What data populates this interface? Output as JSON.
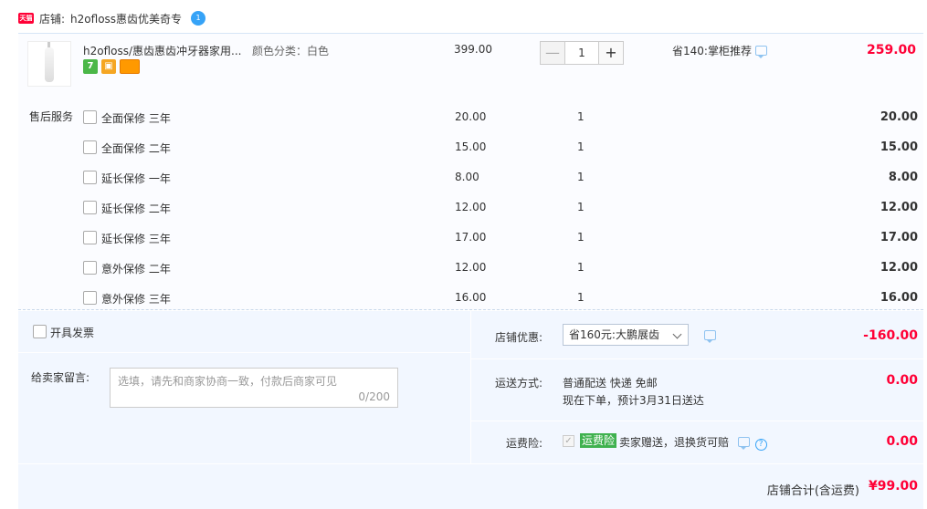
{
  "shop": {
    "platform_badge": "天猫",
    "label": "店铺:",
    "name": "h2ofloss惠齿优美奇专",
    "chat_badge": "1"
  },
  "product": {
    "title": "h2ofloss/惠齿惠齿冲牙器家用...",
    "sku": "颜色分类：白色",
    "unit_price": "399.00",
    "quantity": "1",
    "minus_label": "—",
    "plus_label": "+",
    "promo": "省140:掌柜推荐",
    "line_total": "259.00",
    "badge_7": "7"
  },
  "service": {
    "label": "售后服务",
    "items": [
      {
        "name": "全面保修 三年",
        "price": "20.00",
        "qty": "1",
        "total": "20.00"
      },
      {
        "name": "全面保修 二年",
        "price": "15.00",
        "qty": "1",
        "total": "15.00"
      },
      {
        "name": "延长保修 一年",
        "price": "8.00",
        "qty": "1",
        "total": "8.00"
      },
      {
        "name": "延长保修 二年",
        "price": "12.00",
        "qty": "1",
        "total": "12.00"
      },
      {
        "name": "延长保修 三年",
        "price": "17.00",
        "qty": "1",
        "total": "17.00"
      },
      {
        "name": "意外保修 二年",
        "price": "12.00",
        "qty": "1",
        "total": "12.00"
      },
      {
        "name": "意外保修 三年",
        "price": "16.00",
        "qty": "1",
        "total": "16.00"
      }
    ]
  },
  "invoice": {
    "label": "开具发票"
  },
  "memo": {
    "label": "给卖家留言:",
    "placeholder": "选填，请先和商家协商一致，付款后商家可见",
    "count": "0/200"
  },
  "coupon": {
    "label": "店铺优惠:",
    "selected": "省160元:大鹏展齿",
    "value": "-160.00"
  },
  "shipping": {
    "label": "运送方式:",
    "method": "普通配送 快递 免邮",
    "eta": "现在下单，预计3月31日送达",
    "value": "0.00"
  },
  "insurance": {
    "label": "运费险:",
    "tag": "运费险",
    "desc": "卖家赠送，退换货可赔",
    "value": "0.00",
    "help": "?"
  },
  "total": {
    "label": "店铺合计(含运费)",
    "value": "¥99.00"
  },
  "colors": {
    "accent_red": "#ff0036",
    "panel_bg": "#f2f7ff",
    "insurance_green": "#3fb14f"
  }
}
